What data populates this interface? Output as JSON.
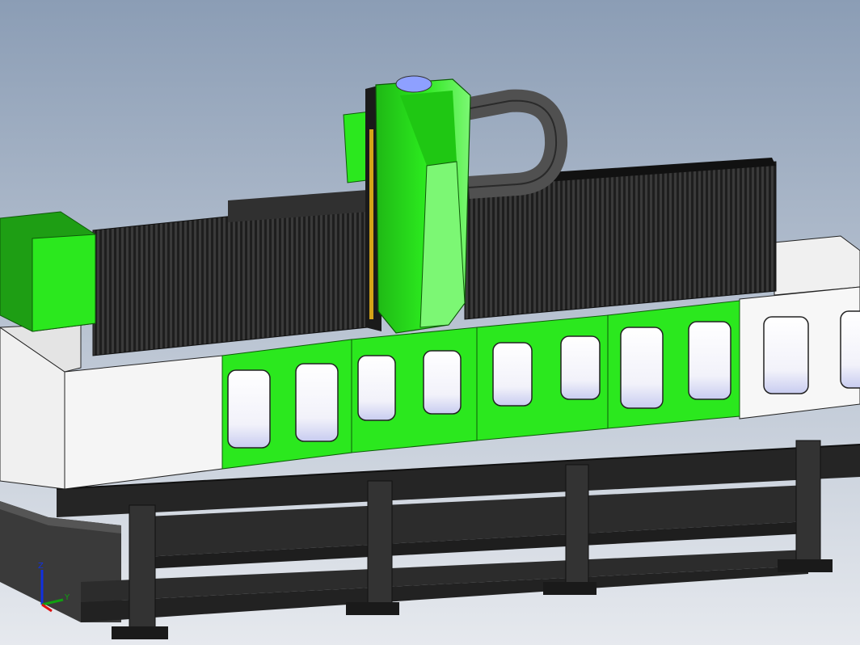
{
  "viewport": {
    "background_top": "#8B9DB5",
    "background_bottom": "#E6E9EE"
  },
  "colors": {
    "machine_green": "#2BE81E",
    "machine_green_dark": "#1E9E14",
    "machine_green_light": "#7CF774",
    "bellows": "#2A2A2A",
    "frame_black": "#2C2C2C",
    "frame_dark": "#1A1A1A",
    "body_white": "#F5F5F5",
    "window_glass": "#FFFFFF",
    "cable_carrier": "#505050",
    "spindle_cap": "#8EA0FF",
    "rail_gold": "#D4A418"
  },
  "triad": {
    "x_axis_color": "#E01010",
    "y_axis_color": "#10A010",
    "z_axis_color": "#1030E0",
    "y_label": "Y",
    "z_label": "Z"
  }
}
